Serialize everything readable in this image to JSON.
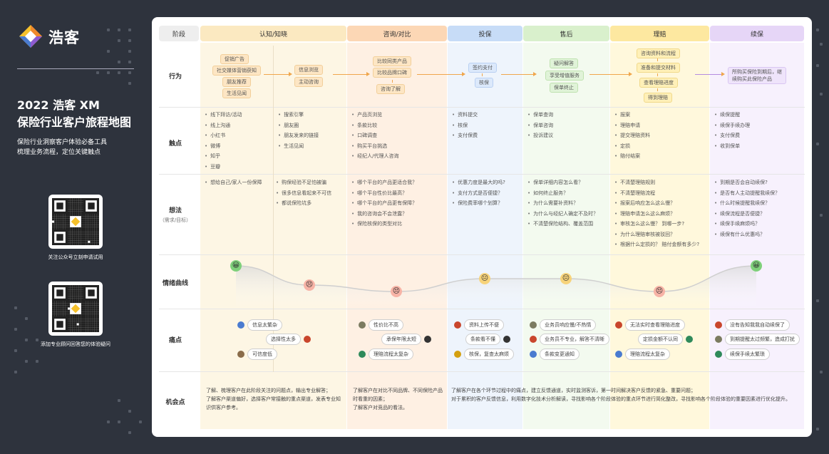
{
  "brand": {
    "name": "浩客",
    "title_line1": "2022 浩客 XM",
    "title_line2": "保险行业客户旅程地图",
    "subtitle_line1": "保险行业洞察客户体验必备工具",
    "subtitle_line2": "梳理业务流程，定位关键触点",
    "qr1_caption": "关注公众号立刻申请试用",
    "qr2_caption": "添加专业顾问回答您的体验疑问"
  },
  "header": {
    "stage_label": "阶段",
    "stages": [
      "认知/知晓",
      "咨询/对比",
      "投保",
      "售后",
      "理赔",
      "续保"
    ]
  },
  "rows": {
    "behavior": "行为",
    "touchpoints": "触点",
    "thoughts": "想法",
    "thoughts_sub": "（需求/目标）",
    "emotion": "情绪曲线",
    "pain": "痛点",
    "opportunity": "机会点"
  },
  "behavior": {
    "awareness_a": [
      "促销广告",
      "社交媒体营销获知",
      "朋友推荐",
      "生活见闻"
    ],
    "awareness_b": [
      "信息浏览",
      "主动咨询"
    ],
    "consult": [
      "比较同类产品",
      "比较品牌口碑",
      "咨询了解"
    ],
    "insure": [
      "签约支付",
      "核保"
    ],
    "after": [
      "疑问解答",
      "享受增值服务",
      "保单终止"
    ],
    "claims": [
      "咨询资料和流程",
      "准备和提交材料",
      "查看理赔进度",
      "得到理赔"
    ],
    "renew": "所购买保险到期后，继续购买此保险产品"
  },
  "touchpoints": {
    "awareness_a": [
      "线下拜访/活动",
      "线上沟通",
      "小红书",
      "微博",
      "知乎",
      "豆瓣"
    ],
    "awareness_b": [
      "搜索引擎",
      "朋友圈",
      "朋友发来的链接",
      "生活见闻"
    ],
    "consult": [
      "产品页浏览",
      "条款比较",
      "口碑调查",
      "购买平台挑选",
      "经纪人/代理人咨询"
    ],
    "insure": [
      "资料提交",
      "核保",
      "支付保费"
    ],
    "after": [
      "保单查询",
      "保单咨询",
      "投诉建议"
    ],
    "claims": [
      "报案",
      "理赔申请",
      "提交理赔资料",
      "定损",
      "赔付结案"
    ],
    "renew": [
      "续保提醒",
      "续保手续办理",
      "支付保费",
      "收到保单"
    ]
  },
  "thoughts": {
    "awareness_a": [
      "想给自己/家人一份保障"
    ],
    "awareness_b": [
      "购保经验不足怕被骗",
      "很多信息看起来不可信",
      "都说保险坑多"
    ],
    "consult": [
      "哪个平台的产品更适合我？",
      "哪个平台性价比最高？",
      "哪个平台的产品更有保障？",
      "我的咨询会不会泄露？",
      "保险核保的类型对比"
    ],
    "insure": [
      "优惠力度是最大的吗?",
      "支付方式是否便捷？",
      "保险费率哪个划算？"
    ],
    "after": [
      "保单详细内容怎么看？",
      "如何终止服务？",
      "为什么需要补资料？",
      "为什么与经纪人确定不及时？",
      "不清楚保险结构、覆盖范围"
    ],
    "claims": [
      "不清楚理赔规则",
      "不清楚理赔流程",
      "报案后响应怎么这么慢？",
      "理赔申请怎么这么麻烦？",
      "审核怎么这么慢？ 到哪一步?",
      "为什么理赔审核被驳回？",
      "根据什么定损的？ 赔付金额有多少?"
    ],
    "renew": [
      "到期是否会自动续保?",
      "是否有人主动提醒我续保？",
      "什么时候提醒我续保？",
      "续保流程是否便捷？",
      "续保手续麻烦吗？",
      "续保有什么优惠吗？"
    ]
  },
  "emotion": {
    "scores": [
      5,
      2,
      1,
      3,
      3,
      1,
      5
    ],
    "faces": [
      "😀",
      "😣",
      "😣",
      "😐",
      "😐",
      "😣",
      "😀"
    ]
  },
  "pain": [
    {
      "text": "信息太繁杂",
      "color": "#4a7bd0"
    },
    {
      "text": "选择性太多",
      "color": "#c9462c"
    },
    {
      "text": "可信度低",
      "color": "#8a6c4a"
    },
    {
      "text": "性价比不高",
      "color": "#7b7b60"
    },
    {
      "text": "承保年限太短",
      "color": "#333333"
    },
    {
      "text": "理赔流程太复杂",
      "color": "#2f8a5a"
    },
    {
      "text": "资料上传不便",
      "color": "#c9462c"
    },
    {
      "text": "条款看不懂",
      "color": "#333333"
    },
    {
      "text": "核保，复查太麻烦",
      "color": "#d4a010"
    },
    {
      "text": "业务员响应慢/不热情",
      "color": "#7b7b60"
    },
    {
      "text": "业务员不专业，解答不清晰",
      "color": "#c9462c"
    },
    {
      "text": "条款变更通知",
      "color": "#4a7bd0"
    },
    {
      "text": "无法实时查看理赔进度",
      "color": "#c9462c"
    },
    {
      "text": "定损金额不认同",
      "color": "#2f8a5a"
    },
    {
      "text": "理赔流程太复杂",
      "color": "#4a7bd0"
    },
    {
      "text": "没有告知我我自动续保了",
      "color": "#c9462c"
    },
    {
      "text": "到期提醒太过频繁，造成打扰",
      "color": "#7b7b60"
    },
    {
      "text": "续保手续太繁琐",
      "color": "#2f8a5a"
    }
  ],
  "opportunity": {
    "awareness": [
      "了解、梳理客户在此阶段关注的问题点，输出专业解答；",
      "了解客户渠道偏好，选择客户常接触的重点渠道，发表专业知识供客户参考。"
    ],
    "consult": [
      "了解客户在对比不同品牌、不同保险产品时看重的因素；",
      "了解客户对竞品的看法。"
    ],
    "later": [
      "了解客户在各个环节过程中的痛点，建立反馈通道，实时监测客诉，第一时间解决客户反馈的紧急、重要问题；",
      "对于累积的客户反馈信息，利用数字化技术分析解读，寻找影响各个阶段体验的重点环节进行简化整改，寻找影响各个阶段体验的重要因素进行优化提升。"
    ]
  },
  "colors": {
    "awareness": "#fbe9c1",
    "consult": "#fcd7b5",
    "insure": "#c7dcf7",
    "after": "#d9f0cc",
    "claims": "#fde8a0",
    "renew": "#e6d6f7"
  }
}
